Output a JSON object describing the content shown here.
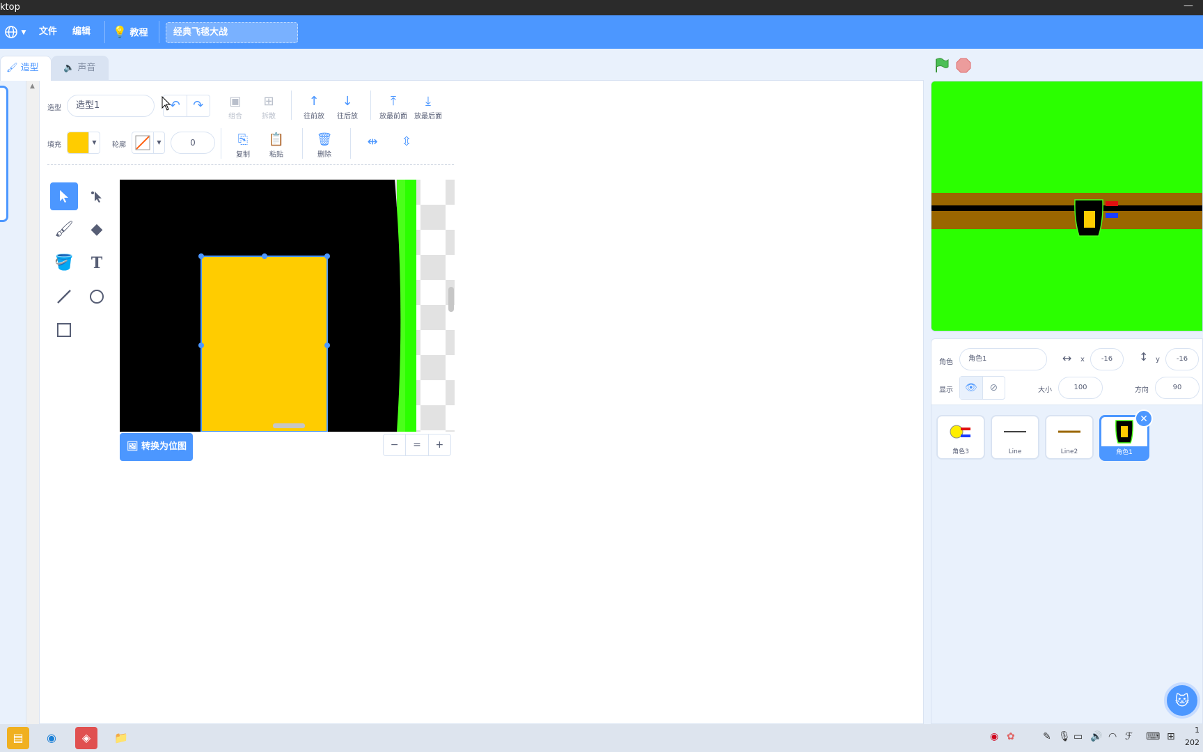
{
  "window": {
    "title_fragment": "ktop",
    "minimize_glyph": "—"
  },
  "menubar": {
    "language_icon": "globe-icon",
    "file": "文件",
    "edit": "编辑",
    "tutorial": "教程",
    "project_title": "经典飞毯大战"
  },
  "tabs": {
    "costume": "造型",
    "sound": "声音"
  },
  "editor": {
    "costume_label": "造型",
    "costume_name": "造型1",
    "group": "组合",
    "ungroup": "拆散",
    "forward": "往前放",
    "backward": "往后放",
    "front": "放最前面",
    "back": "放最后面",
    "fill_label": "填充",
    "outline_label": "轮廓",
    "outline_width": "0",
    "copy": "复制",
    "paste": "粘贴",
    "delete": "删除",
    "fill_color": "#ffcc00",
    "convert_bitmap": "转换为位图",
    "zoom_out": "−",
    "zoom_reset": "=",
    "zoom_in": "+"
  },
  "stage": {
    "background_color": "#2bff00"
  },
  "sprite_info": {
    "sprite_label": "角色",
    "sprite_name": "角色1",
    "x_label": "x",
    "x_value": "-16",
    "y_label": "y",
    "y_value": "-16",
    "show_label": "显示",
    "size_label": "大小",
    "size_value": "100",
    "direction_label": "方向",
    "direction_value": "90"
  },
  "sprites": [
    {
      "name": "角色3"
    },
    {
      "name": "Line"
    },
    {
      "name": "Line2"
    },
    {
      "name": "角色1",
      "selected": true
    }
  ],
  "taskbar": {
    "clock_fragment_top": "1",
    "clock_fragment_bottom": "202"
  }
}
